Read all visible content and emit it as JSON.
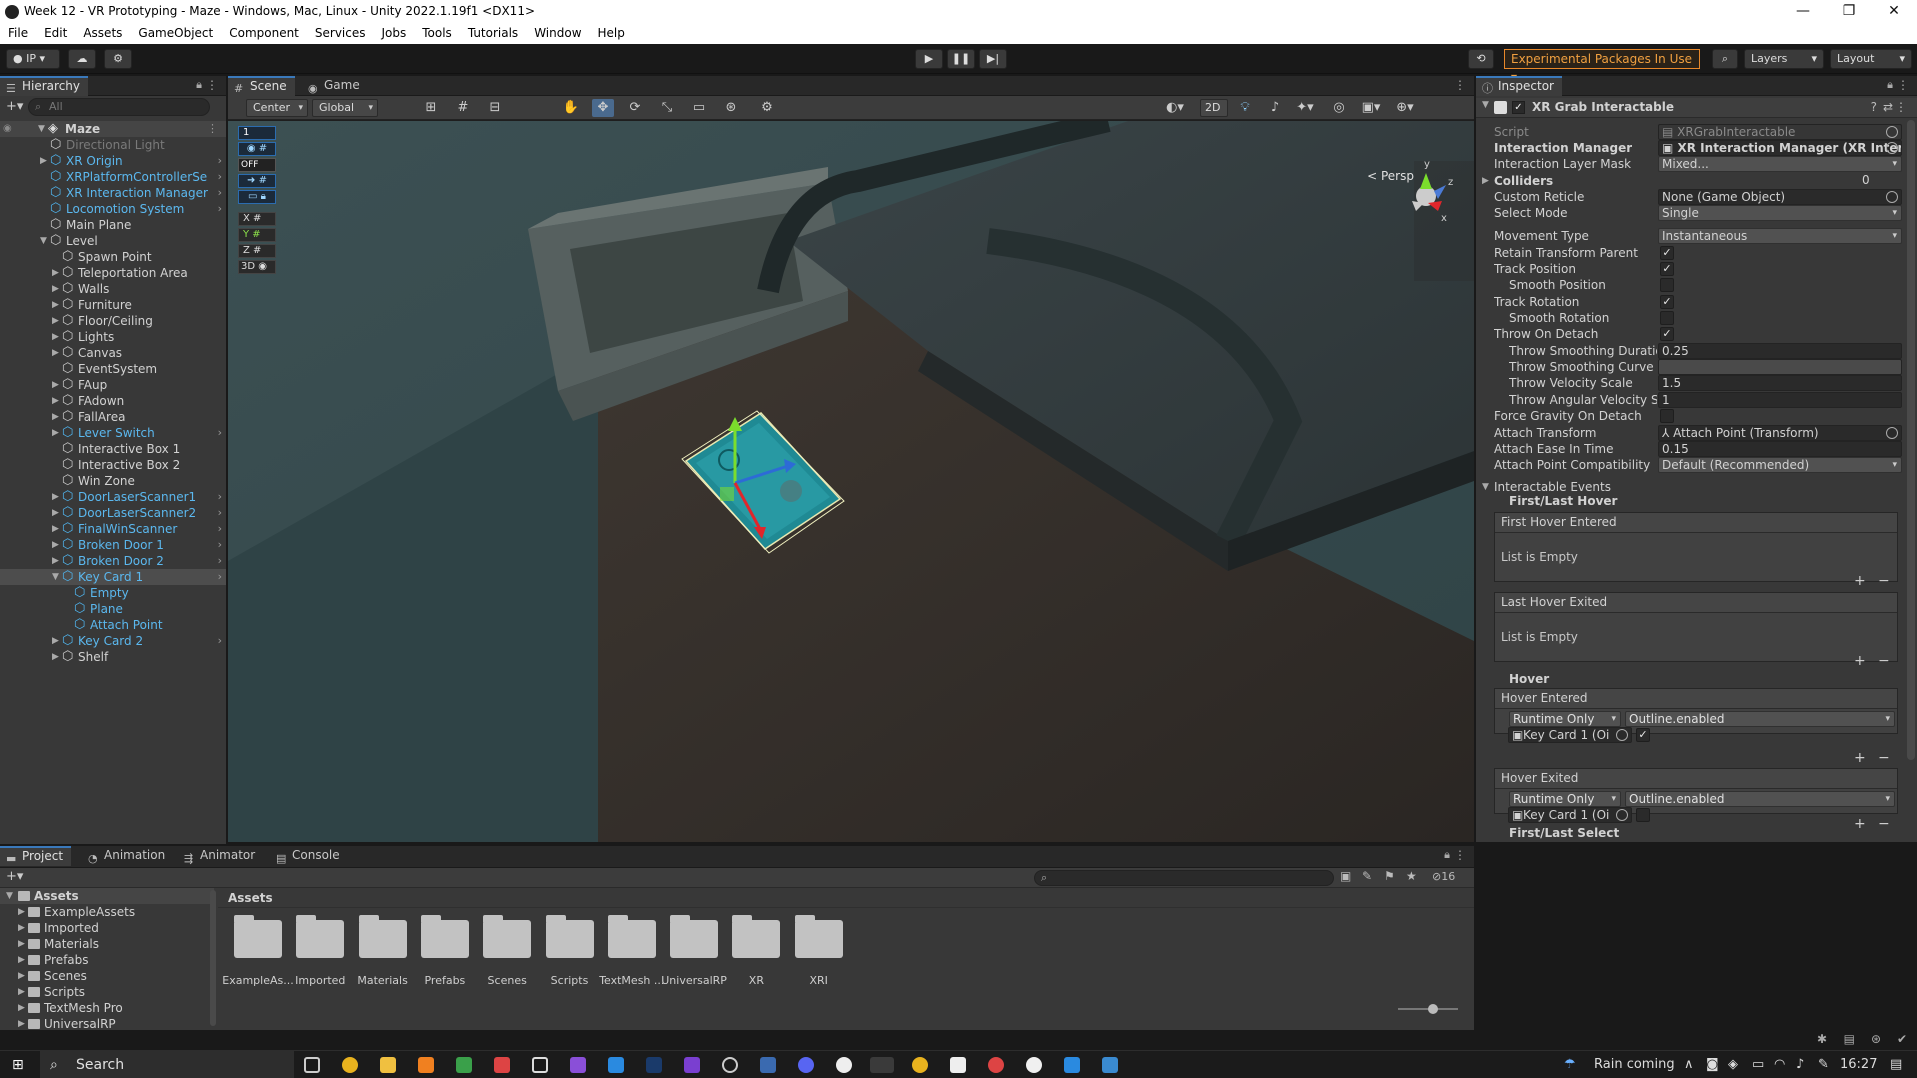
{
  "window": {
    "title": "Week 12 - VR Prototyping - Maze - Windows, Mac, Linux - Unity 2022.1.19f1 <DX11>",
    "controls": [
      "—",
      "❐",
      "✕"
    ]
  },
  "menu": [
    "File",
    "Edit",
    "Assets",
    "GameObject",
    "Component",
    "Services",
    "Jobs",
    "Tools",
    "Tutorials",
    "Window",
    "Help"
  ],
  "toolbar": {
    "account": "IP",
    "experimental": "Experimental Packages In Use",
    "layers": "Layers",
    "layout": "Layout"
  },
  "hierarchy": {
    "tab": "Hierarchy",
    "search_placeholder": "All",
    "root": "Maze",
    "items": [
      {
        "label": "Directional Light",
        "depth": 1,
        "style": "dim",
        "arrow": ""
      },
      {
        "label": "XR Origin",
        "depth": 1,
        "style": "blue",
        "arrow": "▶",
        "more": true
      },
      {
        "label": "XRPlatformControllerSe",
        "depth": 1,
        "style": "blue",
        "arrow": "",
        "more": true
      },
      {
        "label": "XR Interaction Manager",
        "depth": 1,
        "style": "blue",
        "arrow": "",
        "more": true
      },
      {
        "label": "Locomotion System",
        "depth": 1,
        "style": "blue",
        "arrow": "",
        "more": true
      },
      {
        "label": "Main Plane",
        "depth": 1,
        "style": "",
        "arrow": ""
      },
      {
        "label": "Level",
        "depth": 1,
        "style": "",
        "arrow": "▼"
      },
      {
        "label": "Spawn Point",
        "depth": 2,
        "style": "",
        "arrow": ""
      },
      {
        "label": "Teleportation Area",
        "depth": 2,
        "style": "",
        "arrow": "▶"
      },
      {
        "label": "Walls",
        "depth": 2,
        "style": "",
        "arrow": "▶"
      },
      {
        "label": "Furniture",
        "depth": 2,
        "style": "",
        "arrow": "▶"
      },
      {
        "label": "Floor/Ceiling",
        "depth": 2,
        "style": "",
        "arrow": "▶"
      },
      {
        "label": "Lights",
        "depth": 2,
        "style": "",
        "arrow": "▶"
      },
      {
        "label": "Canvas",
        "depth": 2,
        "style": "",
        "arrow": "▶"
      },
      {
        "label": "EventSystem",
        "depth": 2,
        "style": "",
        "arrow": ""
      },
      {
        "label": "FAup",
        "depth": 2,
        "style": "",
        "arrow": "▶"
      },
      {
        "label": "FAdown",
        "depth": 2,
        "style": "",
        "arrow": "▶"
      },
      {
        "label": "FallArea",
        "depth": 2,
        "style": "",
        "arrow": "▶"
      },
      {
        "label": "Lever Switch",
        "depth": 2,
        "style": "blue",
        "arrow": "▶",
        "more": true
      },
      {
        "label": "Interactive Box 1",
        "depth": 2,
        "style": "",
        "arrow": ""
      },
      {
        "label": "Interactive Box 2",
        "depth": 2,
        "style": "",
        "arrow": ""
      },
      {
        "label": "Win Zone",
        "depth": 2,
        "style": "",
        "arrow": ""
      },
      {
        "label": "DoorLaserScanner1",
        "depth": 2,
        "style": "blue",
        "arrow": "▶",
        "more": true
      },
      {
        "label": "DoorLaserScanner2",
        "depth": 2,
        "style": "blue",
        "arrow": "▶",
        "more": true
      },
      {
        "label": "FinalWinScanner",
        "depth": 2,
        "style": "blue",
        "arrow": "▶",
        "more": true
      },
      {
        "label": "Broken Door 1",
        "depth": 2,
        "style": "blue",
        "arrow": "▶",
        "more": true
      },
      {
        "label": "Broken Door 2",
        "depth": 2,
        "style": "blue",
        "arrow": "▶",
        "more": true
      },
      {
        "label": "Key Card 1",
        "depth": 2,
        "style": "blue",
        "arrow": "▼",
        "more": true,
        "selected": true
      },
      {
        "label": "Empty",
        "depth": 3,
        "style": "blue",
        "arrow": ""
      },
      {
        "label": "Plane",
        "depth": 3,
        "style": "blue",
        "arrow": ""
      },
      {
        "label": "Attach Point",
        "depth": 3,
        "style": "blue",
        "arrow": ""
      },
      {
        "label": "Key Card 2",
        "depth": 2,
        "style": "blue",
        "arrow": "▶",
        "more": true
      },
      {
        "label": "Shelf",
        "depth": 2,
        "style": "",
        "arrow": "▶"
      }
    ]
  },
  "scene": {
    "tabs": [
      "Scene",
      "Game"
    ],
    "pivot": "Center",
    "space": "Global",
    "mode_2d": "2D",
    "persp": "< Persp",
    "overlay": [
      "1",
      "OFF",
      "X",
      "Y",
      "Z",
      "3D"
    ]
  },
  "inspector": {
    "tab": "Inspector",
    "component": "XR Grab Interactable",
    "script": {
      "label": "Script",
      "value": "XRGrabInteractable"
    },
    "interaction_manager": {
      "label": "Interaction Manager",
      "value": "XR Interaction Manager (XR Interacti"
    },
    "layer_mask": {
      "label": "Interaction Layer Mask",
      "value": "Mixed..."
    },
    "colliders": {
      "label": "Colliders",
      "value": "0"
    },
    "custom_reticle": {
      "label": "Custom Reticle",
      "value": "None (Game Object)"
    },
    "select_mode": {
      "label": "Select Mode",
      "value": "Single"
    },
    "movement_type": {
      "label": "Movement Type",
      "value": "Instantaneous"
    },
    "retain_parent": {
      "label": "Retain Transform Parent",
      "checked": "✓"
    },
    "track_position": {
      "label": "Track Position",
      "checked": "✓"
    },
    "smooth_position": {
      "label": "Smooth Position",
      "checked": ""
    },
    "track_rotation": {
      "label": "Track Rotation",
      "checked": "✓"
    },
    "smooth_rotation": {
      "label": "Smooth Rotation",
      "checked": ""
    },
    "throw_on_detach": {
      "label": "Throw On Detach",
      "checked": "✓"
    },
    "throw_smoothing_duration": {
      "label": "Throw Smoothing Duratio",
      "value": "0.25"
    },
    "throw_smoothing_curve": {
      "label": "Throw Smoothing Curve",
      "value": ""
    },
    "throw_velocity_scale": {
      "label": "Throw Velocity Scale",
      "value": "1.5"
    },
    "throw_angular_scale": {
      "label": "Throw Angular Velocity Sc",
      "value": "1"
    },
    "force_gravity": {
      "label": "Force Gravity On Detach",
      "checked": ""
    },
    "attach_transform": {
      "label": "Attach Transform",
      "value": "Attach Point (Transform)"
    },
    "attach_ease": {
      "label": "Attach Ease In Time",
      "value": "0.15"
    },
    "attach_compat": {
      "label": "Attach Point Compatibility M",
      "value": "Default (Recommended)"
    },
    "events_header": "Interactable Events",
    "first_last_hover": "First/Last Hover",
    "first_hover_entered": "First Hover Entered",
    "list_empty": "List is Empty",
    "last_hover_exited": "Last Hover Exited",
    "hover": "Hover",
    "hover_entered": "Hover Entered",
    "hover_exited": "Hover Exited",
    "runtime_only": "Runtime Only",
    "outline_enabled": "Outline.enabled",
    "key_card_ref": "Key Card 1 (Oi",
    "hover_entered_checked": "✓",
    "hover_exited_checked": "",
    "first_last_select": "First/Last Select",
    "plus": "+",
    "minus": "−"
  },
  "project": {
    "tabs": [
      "Project",
      "Animation",
      "Animator",
      "Console"
    ],
    "hidden_count": "16",
    "tree_root": "Assets",
    "tree": [
      "ExampleAssets",
      "Imported",
      "Materials",
      "Prefabs",
      "Scenes",
      "Scripts",
      "TextMesh Pro",
      "UniversalRP"
    ],
    "breadcrumb": "Assets",
    "assets": [
      "ExampleAs...",
      "Imported",
      "Materials",
      "Prefabs",
      "Scenes",
      "Scripts",
      "TextMesh ...",
      "UniversalRP",
      "XR",
      "XRI"
    ]
  },
  "taskbar": {
    "search": "Search",
    "weather": "Rain coming",
    "time": "16:27"
  },
  "colors": {
    "accent_blue": "#3a79bb",
    "prefab_blue": "#5bb8ef",
    "warning_orange": "#e8882a"
  }
}
